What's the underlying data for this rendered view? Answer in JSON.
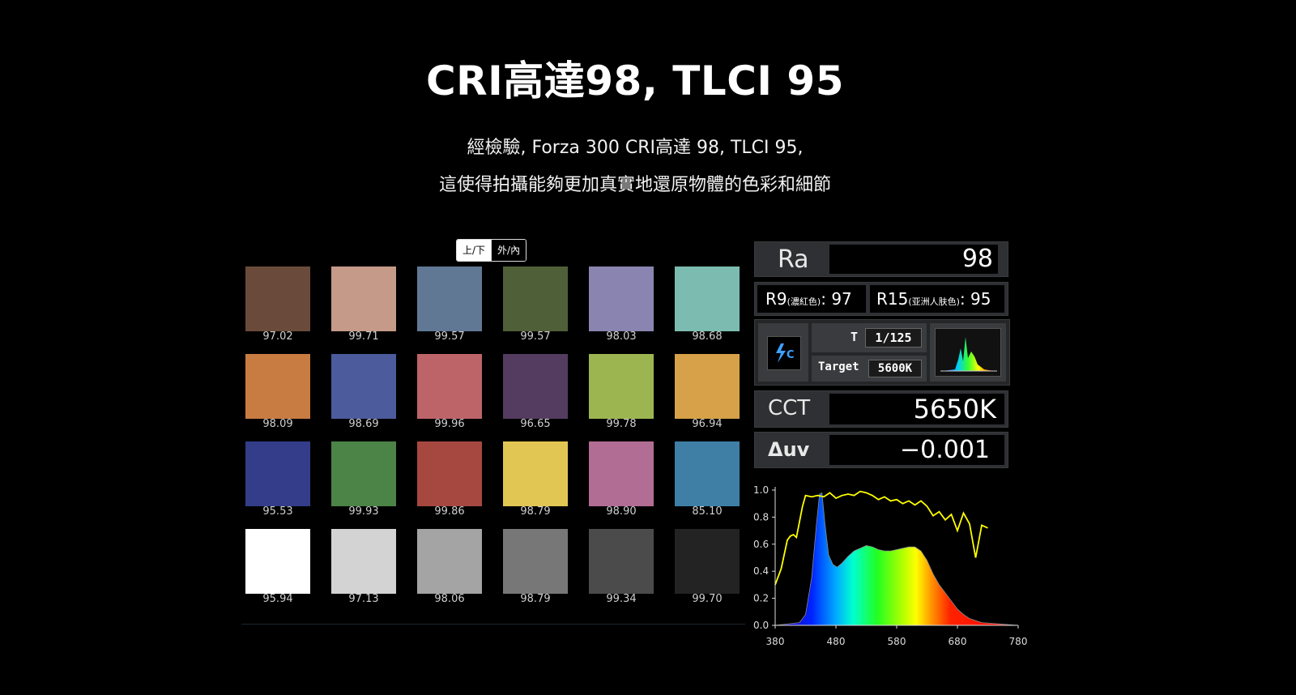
{
  "header": {
    "title": "CRI高達98, TLCI 95",
    "subtitle_line1": "經檢驗, Forza 300 CRI高達 98, TLCI 95,",
    "subtitle_line2": "這使得拍攝能夠更加真實地還原物體的色彩和細節"
  },
  "toggle": {
    "option_1": "上/下",
    "option_2": "外/內"
  },
  "swatches": [
    {
      "color": "#6a4b3b",
      "value": "97.02"
    },
    {
      "color": "#c59a89",
      "value": "99.71"
    },
    {
      "color": "#617895",
      "value": "99.57"
    },
    {
      "color": "#4f5f38",
      "value": "99.57"
    },
    {
      "color": "#8a84b0",
      "value": "98.03"
    },
    {
      "color": "#7cbcb0",
      "value": "98.68"
    },
    {
      "color": "#c97c42",
      "value": "98.09"
    },
    {
      "color": "#4c5b9b",
      "value": "98.69"
    },
    {
      "color": "#bd6468",
      "value": "99.96"
    },
    {
      "color": "#533c5f",
      "value": "96.65"
    },
    {
      "color": "#9db551",
      "value": "99.78"
    },
    {
      "color": "#d6a148",
      "value": "96.94"
    },
    {
      "color": "#333d8a",
      "value": "95.53"
    },
    {
      "color": "#4b8446",
      "value": "99.93"
    },
    {
      "color": "#a64840",
      "value": "99.86"
    },
    {
      "color": "#e2c653",
      "value": "98.79"
    },
    {
      "color": "#b26d94",
      "value": "98.90"
    },
    {
      "color": "#3f7fa6",
      "value": "85.10"
    },
    {
      "color": "#ffffff",
      "value": "95.94"
    },
    {
      "color": "#d3d3d3",
      "value": "97.13"
    },
    {
      "color": "#a4a4a4",
      "value": "98.06"
    },
    {
      "color": "#777777",
      "value": "98.79"
    },
    {
      "color": "#4b4b4b",
      "value": "99.34"
    },
    {
      "color": "#232323",
      "value": "99.70"
    }
  ],
  "meter": {
    "ra_label": "Ra",
    "ra_value": "98",
    "r9_label": "R9",
    "r9_note": "(濃紅色)",
    "r9_value": ": 97",
    "r15_label": "R15",
    "r15_note": "(亚洲人肤色)",
    "r15_value": ": 95",
    "mode_icon": "flash-c-icon",
    "t_label": "T",
    "t_value": "1/125",
    "target_label": "Target",
    "target_value": "5600K",
    "cct_label": "CCT",
    "cct_value": "5650K",
    "duv_label": "Δuv",
    "duv_value": "−0.001"
  },
  "chart_data": {
    "type": "area",
    "xlim": [
      380,
      780
    ],
    "ylim": [
      0,
      1.0
    ],
    "x_ticks": [
      380,
      480,
      580,
      680,
      780
    ],
    "y_ticks": [
      "0.0",
      "0.2",
      "0.4",
      "0.6",
      "0.8",
      "1.0"
    ],
    "series": [
      {
        "kind": "spectrum",
        "points": [
          [
            380,
            0.0
          ],
          [
            420,
            0.02
          ],
          [
            430,
            0.08
          ],
          [
            440,
            0.35
          ],
          [
            448,
            0.75
          ],
          [
            453,
            0.97
          ],
          [
            457,
            0.98
          ],
          [
            462,
            0.75
          ],
          [
            468,
            0.52
          ],
          [
            475,
            0.45
          ],
          [
            482,
            0.43
          ],
          [
            490,
            0.46
          ],
          [
            500,
            0.51
          ],
          [
            510,
            0.55
          ],
          [
            520,
            0.57
          ],
          [
            530,
            0.59
          ],
          [
            540,
            0.58
          ],
          [
            550,
            0.56
          ],
          [
            560,
            0.55
          ],
          [
            570,
            0.55
          ],
          [
            580,
            0.56
          ],
          [
            590,
            0.57
          ],
          [
            600,
            0.58
          ],
          [
            610,
            0.58
          ],
          [
            620,
            0.55
          ],
          [
            630,
            0.48
          ],
          [
            640,
            0.38
          ],
          [
            650,
            0.3
          ],
          [
            660,
            0.24
          ],
          [
            670,
            0.18
          ],
          [
            680,
            0.12
          ],
          [
            690,
            0.08
          ],
          [
            700,
            0.05
          ],
          [
            720,
            0.02
          ],
          [
            750,
            0.01
          ],
          [
            780,
            0.0
          ]
        ]
      },
      {
        "kind": "cri-curve",
        "color": "#ffff00",
        "points": [
          [
            380,
            0.3
          ],
          [
            390,
            0.42
          ],
          [
            400,
            0.63
          ],
          [
            405,
            0.66
          ],
          [
            410,
            0.67
          ],
          [
            415,
            0.65
          ],
          [
            425,
            0.88
          ],
          [
            430,
            0.96
          ],
          [
            440,
            0.95
          ],
          [
            450,
            0.96
          ],
          [
            460,
            0.95
          ],
          [
            470,
            0.98
          ],
          [
            480,
            0.94
          ],
          [
            490,
            0.96
          ],
          [
            500,
            0.97
          ],
          [
            510,
            0.96
          ],
          [
            520,
            0.99
          ],
          [
            530,
            0.98
          ],
          [
            540,
            0.96
          ],
          [
            550,
            0.93
          ],
          [
            560,
            0.95
          ],
          [
            570,
            0.92
          ],
          [
            580,
            0.93
          ],
          [
            590,
            0.9
          ],
          [
            600,
            0.92
          ],
          [
            610,
            0.89
          ],
          [
            620,
            0.92
          ],
          [
            630,
            0.88
          ],
          [
            640,
            0.81
          ],
          [
            650,
            0.84
          ],
          [
            660,
            0.78
          ],
          [
            670,
            0.82
          ],
          [
            680,
            0.7
          ],
          [
            690,
            0.83
          ],
          [
            700,
            0.75
          ],
          [
            710,
            0.5
          ],
          [
            720,
            0.74
          ],
          [
            730,
            0.72
          ]
        ]
      }
    ]
  }
}
